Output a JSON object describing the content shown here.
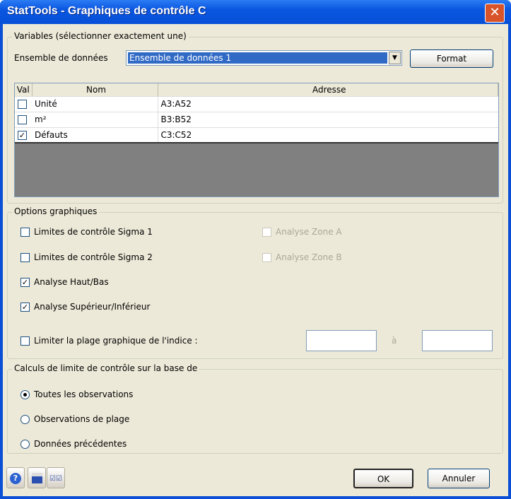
{
  "window": {
    "title": "StatTools - Graphiques de contrôle C",
    "close": "✕"
  },
  "variables": {
    "legend": "Variables (sélectionner exactement une)",
    "dataset_label": "Ensemble de données",
    "dataset_value": "Ensemble de données 1",
    "format_button": "Format",
    "columns": [
      "Val",
      "Nom",
      "Adresse"
    ],
    "rows": [
      {
        "checked": false,
        "name": "Unité",
        "address": "A3:A52"
      },
      {
        "checked": false,
        "name": "m²",
        "address": "B3:B52"
      },
      {
        "checked": true,
        "name": "Défauts",
        "address": "C3:C52"
      }
    ]
  },
  "options": {
    "legend": "Options graphiques",
    "sigma1": {
      "label": "Limites de contrôle Sigma 1",
      "checked": false
    },
    "sigma2": {
      "label": "Limites de contrôle Sigma 2",
      "checked": false
    },
    "haut_bas": {
      "label": "Analyse Haut/Bas",
      "checked": true
    },
    "sup_inf": {
      "label": "Analyse Supérieur/Inférieur",
      "checked": true
    },
    "zone_a": {
      "label": "Analyse Zone A",
      "checked": false,
      "disabled": true
    },
    "zone_b": {
      "label": "Analyse Zone B",
      "checked": false,
      "disabled": true
    },
    "limit_range": {
      "label": "Limiter la plage graphique de l'indice :",
      "checked": false,
      "from": "",
      "to_label": "à",
      "to": ""
    }
  },
  "calc": {
    "legend": "Calculs de limite de contrôle sur la base de",
    "options": [
      "Toutes les observations",
      "Observations de plage",
      "Données précédentes"
    ],
    "selected": 0
  },
  "footer": {
    "ok": "OK",
    "cancel": "Annuler"
  }
}
